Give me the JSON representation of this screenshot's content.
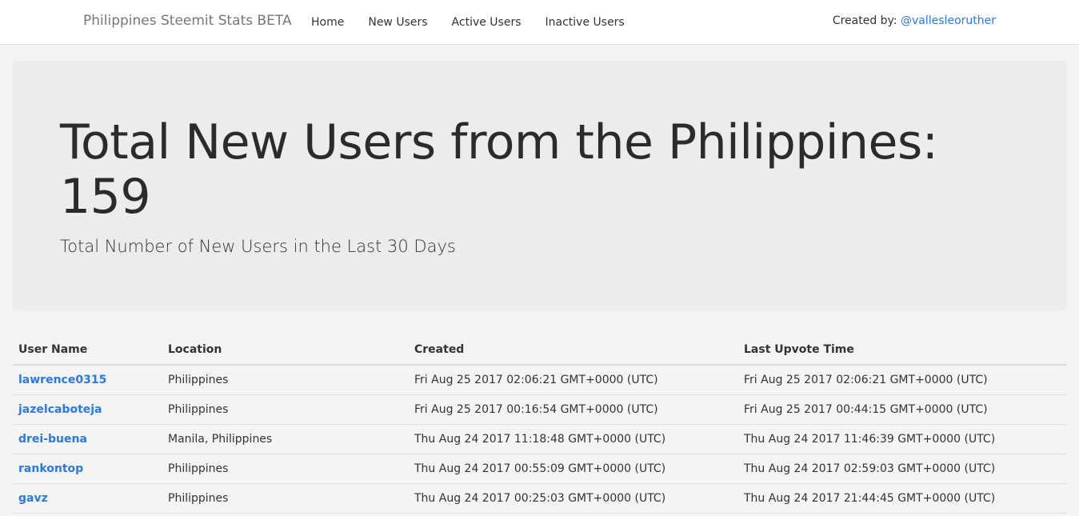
{
  "navbar": {
    "brand": "Philippines Steemit Stats BETA",
    "links": [
      "Home",
      "New Users",
      "Active Users",
      "Inactive Users"
    ],
    "credit_prefix": "Created by: ",
    "credit_user": "@vallesleoruther"
  },
  "hero": {
    "title": "Total New Users from the Philippines: 159",
    "subtitle": "Total Number of New Users in the Last 30 Days"
  },
  "table": {
    "headers": [
      "User Name",
      "Location",
      "Created",
      "Last Upvote Time"
    ],
    "rows": [
      [
        "lawrence0315",
        "Philippines",
        "Fri Aug 25 2017 02:06:21 GMT+0000 (UTC)",
        "Fri Aug 25 2017 02:06:21 GMT+0000 (UTC)"
      ],
      [
        "jazelcaboteja",
        "Philippines",
        "Fri Aug 25 2017 00:16:54 GMT+0000 (UTC)",
        "Fri Aug 25 2017 00:44:15 GMT+0000 (UTC)"
      ],
      [
        "drei-buena",
        "Manila, Philippines",
        "Thu Aug 24 2017 11:18:48 GMT+0000 (UTC)",
        "Thu Aug 24 2017 11:46:39 GMT+0000 (UTC)"
      ],
      [
        "rankontop",
        "Philippines",
        "Thu Aug 24 2017 00:55:09 GMT+0000 (UTC)",
        "Thu Aug 24 2017 02:59:03 GMT+0000 (UTC)"
      ],
      [
        "gavz",
        "Philippines",
        "Thu Aug 24 2017 00:25:03 GMT+0000 (UTC)",
        "Thu Aug 24 2017 21:44:45 GMT+0000 (UTC)"
      ]
    ]
  },
  "colors": {
    "link": "#2a7ae2",
    "jumbotron_bg": "#ececec",
    "page_bg": "#f4f4f4"
  }
}
